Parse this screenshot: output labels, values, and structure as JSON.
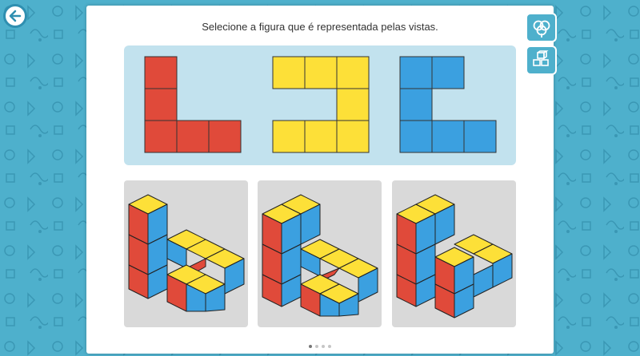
{
  "instruction": "Selecione a figura que é representada pelas vistas.",
  "colors": {
    "background": "#4eb0cc",
    "red": "#e04a3a",
    "yellow": "#fde038",
    "blue": "#3ba0e0",
    "panel": "#c2e2ee",
    "option_bg": "#d9d9d9"
  },
  "views": [
    {
      "name": "red-view",
      "color": "#e04a3a",
      "cells": [
        [
          0,
          0
        ],
        [
          0,
          1
        ],
        [
          0,
          2
        ],
        [
          1,
          2
        ],
        [
          2,
          2
        ]
      ]
    },
    {
      "name": "yellow-view",
      "color": "#fde038",
      "cells": [
        [
          0,
          0
        ],
        [
          1,
          0
        ],
        [
          2,
          0
        ],
        [
          2,
          1
        ],
        [
          0,
          2
        ],
        [
          1,
          2
        ],
        [
          2,
          2
        ]
      ]
    },
    {
      "name": "blue-view",
      "color": "#3ba0e0",
      "cells": [
        [
          0,
          0
        ],
        [
          1,
          0
        ],
        [
          0,
          1
        ],
        [
          0,
          2
        ],
        [
          1,
          2
        ],
        [
          2,
          2
        ]
      ]
    }
  ],
  "options": [
    {
      "name": "option-a"
    },
    {
      "name": "option-b"
    },
    {
      "name": "option-c"
    }
  ],
  "pagination": {
    "total": 4,
    "active": 0
  },
  "side_buttons": [
    {
      "name": "clover-icon"
    },
    {
      "name": "cubes-icon"
    }
  ]
}
